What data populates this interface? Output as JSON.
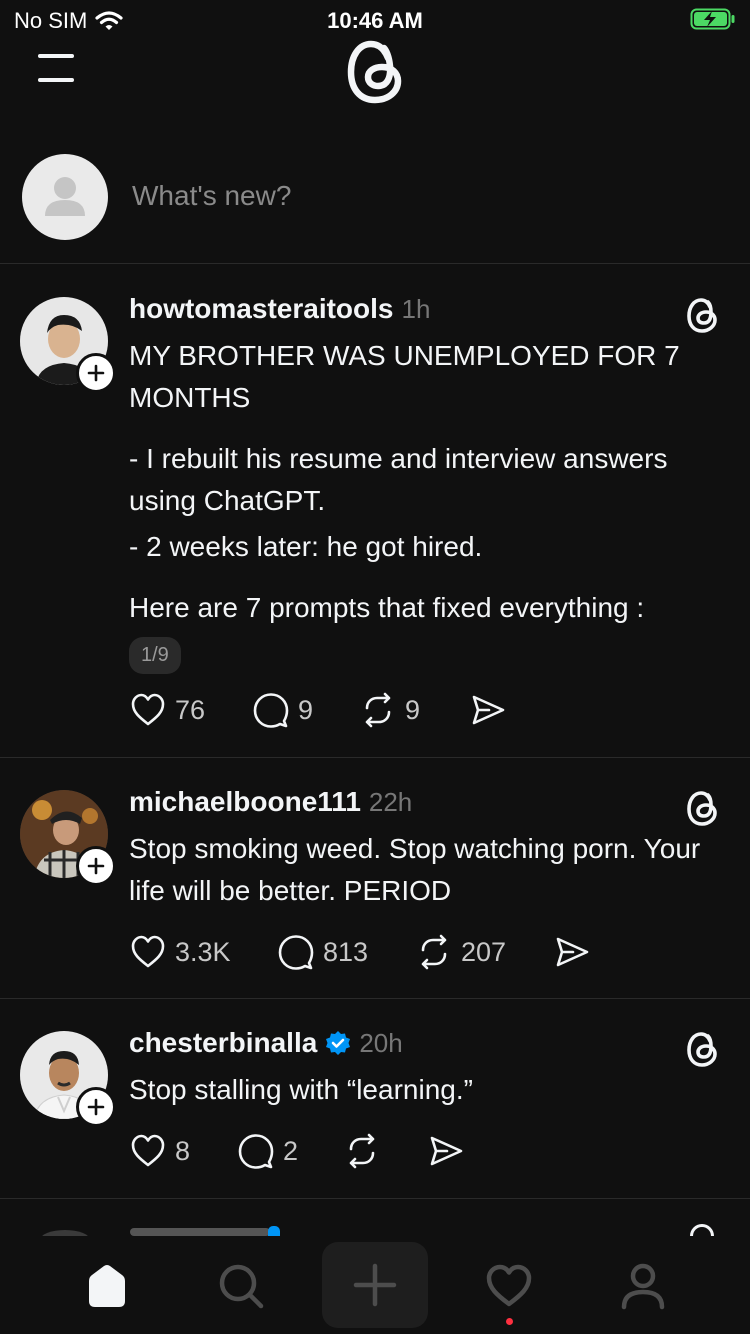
{
  "status_bar": {
    "carrier": "No SIM",
    "time": "10:46 AM"
  },
  "composer": {
    "placeholder": "What's new?"
  },
  "posts": [
    {
      "username": "howtomasteraitools",
      "time": "1h",
      "verified": false,
      "paragraphs": [
        "MY BROTHER WAS UNEMPLOYED FOR 7 MONTHS",
        "- I rebuilt his resume and interview answers using ChatGPT.",
        "- 2 weeks later: he got hired.",
        "Here are 7 prompts that fixed everything :"
      ],
      "carousel_indicator": "1/9",
      "likes": "76",
      "replies": "9",
      "reposts": "9"
    },
    {
      "username": "michaelboone111",
      "time": "22h",
      "verified": false,
      "paragraphs": [
        "Stop smoking weed. Stop watching porn. Your life will be better. PERIOD"
      ],
      "likes": "3.3K",
      "replies": "813",
      "reposts": "207"
    },
    {
      "username": "chesterbinalla",
      "time": "20h",
      "verified": true,
      "paragraphs": [
        "Stop stalling with “learning.”"
      ],
      "likes": "8",
      "replies": "2",
      "reposts": ""
    }
  ],
  "colors": {
    "background": "#101010",
    "text": "#f3f5f7",
    "muted": "#777777",
    "verified": "#0095f6",
    "notification_dot": "#ff3040",
    "battery": "#4cd964"
  },
  "icons": {
    "navigation": [
      "home-icon",
      "search-icon",
      "create-icon",
      "activity-icon",
      "profile-icon"
    ],
    "post_actions": [
      "heart-icon",
      "comment-icon",
      "repost-icon",
      "share-icon"
    ]
  }
}
